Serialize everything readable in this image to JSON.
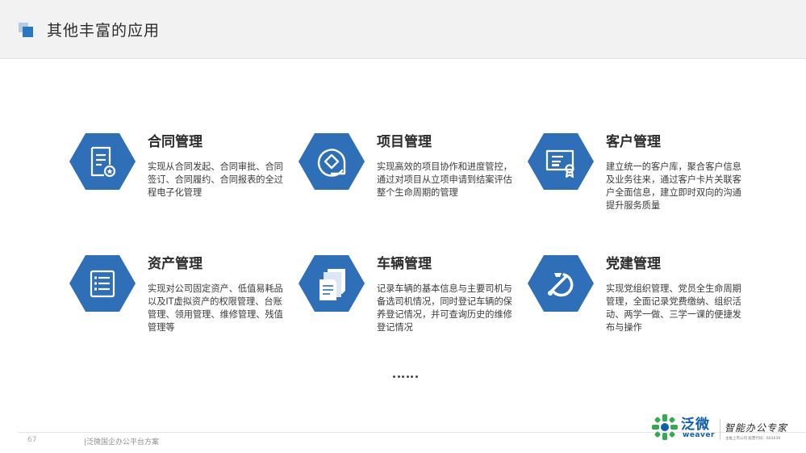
{
  "header": {
    "title": "其他丰富的应用"
  },
  "apps": [
    {
      "title": "合同管理",
      "desc": "实现从合同发起、合同审批、合同签订、合同履约、合同报表的全过程电子化管理",
      "icon": "contract-document-icon"
    },
    {
      "title": "项目管理",
      "desc": "实现高效的项目协作和进度管控，通过对项目从立项申请到结案评估整个生命周期的管理",
      "icon": "project-rhombus-icon"
    },
    {
      "title": "客户管理",
      "desc": "建立统一的客户库，聚合客户信息及业务往来，通过客户卡片关联客户全面信息，建立即时双向的沟通提升服务质量",
      "icon": "customer-certificate-icon"
    },
    {
      "title": "资产管理",
      "desc": "实现对公司固定资产、低值易耗品以及IT虚拟资产的权限管理、台账管理、领用管理、维修管理、残值管理等",
      "icon": "asset-list-icon"
    },
    {
      "title": "车辆管理",
      "desc": "记录车辆的基本信息与主要司机与备选司机情况，同时登记车辆的保养登记情况，并可查询历史的维修登记情况",
      "icon": "vehicle-documents-icon"
    },
    {
      "title": "党建管理",
      "desc": "实现党组织管理、党员全生命周期管理，全面记录党费缴纳、组织活动、两学一做、三学一课的便捷发布与操作",
      "icon": "party-emblem-icon"
    }
  ],
  "more": "……",
  "footer": {
    "page_number": "67",
    "text": "|泛微国企办公平台方案"
  },
  "logo": {
    "name_cn": "泛微",
    "name_en": "weaver",
    "slogan": "智能办公专家",
    "sub": "主板上市公司 股票代码：603039"
  },
  "colors": {
    "accent": "#2a78c2",
    "hex_fill": "#2f6fb8"
  }
}
